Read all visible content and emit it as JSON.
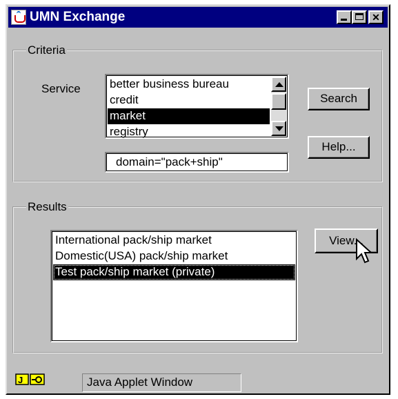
{
  "window": {
    "title": "UMN Exchange"
  },
  "criteria": {
    "legend": "Criteria",
    "service_label": "Service",
    "service_options": [
      "better business bureau",
      "credit",
      "market",
      "registry"
    ],
    "selected_service": "market",
    "query_value": "domain=\"pack+ship\"",
    "search_label": "Search",
    "help_label": "Help..."
  },
  "results": {
    "legend": "Results",
    "items": [
      "International pack/ship market",
      "Domestic(USA) pack/ship market",
      "Test pack/ship market (private)"
    ],
    "selected_item": "Test pack/ship market (private)",
    "view_label": "View..."
  },
  "statusbar": {
    "text": "Java Applet Window",
    "icons": [
      "java-icon",
      "key-icon"
    ]
  }
}
